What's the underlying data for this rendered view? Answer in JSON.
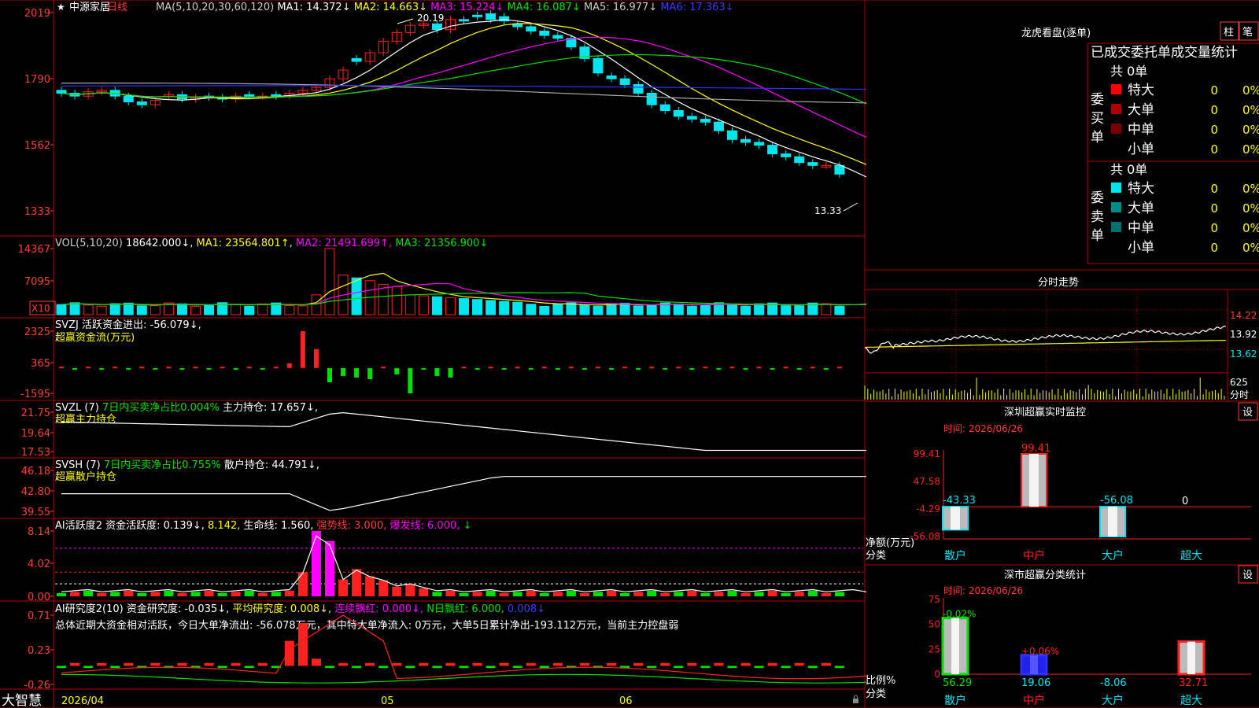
{
  "app": {
    "brand": "大智慧",
    "star": "★",
    "stock_name": "中源家居",
    "period": "日线"
  },
  "colors": {
    "bg": "#000000",
    "grid": "#b00000",
    "up": "#ff2020",
    "down": "#00e5ee",
    "axis_text": "#ff3b3b",
    "white": "#ffffff",
    "yellow": "#ffff00",
    "magenta": "#ff00ff",
    "green": "#00e000",
    "blue": "#3030ff",
    "gray": "#aaaaaa"
  },
  "panels": {
    "price": {
      "header": [
        {
          "t": "MA(5,10,20,30,60,120)",
          "c": "#cccccc"
        },
        {
          "t": "MA1: 14.372↓",
          "c": "#ffffff"
        },
        {
          "t": "MA2: 14.663↓",
          "c": "#ffff00"
        },
        {
          "t": "MA3: 15.224↓",
          "c": "#ff00ff"
        },
        {
          "t": "MA4: 16.087↓",
          "c": "#00e000"
        },
        {
          "t": "MA5: 16.977↓",
          "c": "#cccccc"
        },
        {
          "t": "MA6: 17.363↓",
          "c": "#3a3aff"
        }
      ],
      "y_ticks": [
        "2019",
        "1790",
        "1562",
        "1333"
      ],
      "high_label": "20.19",
      "low_label": "13.33"
    },
    "vol": {
      "header": [
        {
          "t": "VOL(5,10,20)",
          "c": "#cccccc"
        },
        {
          "t": "18642.000↓,",
          "c": "#ffffff"
        },
        {
          "t": "MA1: 23564.801↑,",
          "c": "#ffff00"
        },
        {
          "t": "MA2: 21491.699↑,",
          "c": "#ff00ff"
        },
        {
          "t": "MA3: 21356.900↓",
          "c": "#00e000"
        }
      ],
      "y_ticks": [
        "14367",
        "7095"
      ],
      "unit": "X10"
    },
    "svzj": {
      "header": [
        {
          "t": "SVZJ  活跃资金进出: -56.079↓,",
          "c": "#ffffff"
        }
      ],
      "sub": "超赢资金流(万元)",
      "y_ticks": [
        "2325",
        "365",
        "-1595"
      ]
    },
    "svzl": {
      "header": [
        {
          "t": "SVZL (7)",
          "c": "#ffffff"
        },
        {
          "t": "7日内买卖净占比0.004%",
          "c": "#00e000"
        },
        {
          "t": "主力持仓: 17.657↓,",
          "c": "#ffffff"
        }
      ],
      "sub": "超赢主力持仓",
      "y_ticks": [
        "21.75",
        "19.64",
        "17.53"
      ]
    },
    "svsh": {
      "header": [
        {
          "t": "SVSH (7)",
          "c": "#ffffff"
        },
        {
          "t": "7日内买卖净占比0.755%",
          "c": "#00e000"
        },
        {
          "t": "散户持仓: 44.791↓,",
          "c": "#ffffff"
        }
      ],
      "sub": "超赢散户持仓",
      "y_ticks": [
        "46.18",
        "42.80",
        "39.55"
      ]
    },
    "ai1": {
      "header": [
        {
          "t": "AI活跃度2",
          "c": "#ffffff"
        },
        {
          "t": "资金活跃度: 0.139↓,",
          "c": "#ffffff"
        },
        {
          "t": "8.142,",
          "c": "#ffff00"
        },
        {
          "t": "生命线: 1.560,",
          "c": "#ffffff"
        },
        {
          "t": "强势线: 3.000,",
          "c": "#ff3b3b"
        },
        {
          "t": "爆发线: 6.000,",
          "c": "#ff00ff"
        },
        {
          "t": "↓",
          "c": "#00e000"
        }
      ],
      "y_ticks": [
        "8.14",
        "4.02",
        "0.00"
      ]
    },
    "ai2": {
      "header": [
        {
          "t": "AI研究度2(10)",
          "c": "#ffffff"
        },
        {
          "t": "资金研究度: -0.035↓,",
          "c": "#ffffff"
        },
        {
          "t": "平均研究度: 0.008↓,",
          "c": "#ffff00"
        },
        {
          "t": "连续飘红: 0.000↓,",
          "c": "#ff00ff"
        },
        {
          "t": "N日飘红: 6.000,",
          "c": "#00e000"
        },
        {
          "t": "0.008↓",
          "c": "#3a3aff"
        }
      ],
      "summary": "总体近期大资金相对活跃，今日大单净流出: -56.078万元，其中特大单净流入: 0万元，大单5日累计净出-193.112万元，当前主力控盘弱",
      "y_ticks": [
        "0.71",
        "0.23",
        "-0.26"
      ]
    }
  },
  "x_axis": {
    "labels": [
      "2026/04",
      "05",
      "06"
    ]
  },
  "right": {
    "lhb_title": "龙虎看盘(逐单)",
    "btn_bar": "柱",
    "btn_pen": "笔",
    "stats_title": "已成交委托单成交量统计",
    "buy": {
      "label": "委买单",
      "total": "共 0单",
      "rows": [
        {
          "name": "特大",
          "v": "0",
          "p": "0%",
          "c": "#ff0000"
        },
        {
          "name": "大单",
          "v": "0",
          "p": "0%",
          "c": "#aa0000"
        },
        {
          "name": "中单",
          "v": "0",
          "p": "0%",
          "c": "#770000"
        },
        {
          "name": "小单",
          "v": "0",
          "p": "0%",
          "c": ""
        }
      ]
    },
    "sell": {
      "label": "委卖单",
      "total": "共 0单",
      "rows": [
        {
          "name": "特大",
          "v": "0",
          "p": "0%",
          "c": "#00e5ee"
        },
        {
          "name": "大单",
          "v": "0",
          "p": "0%",
          "c": "#008a8a"
        },
        {
          "name": "中单",
          "v": "0",
          "p": "0%",
          "c": "#006f6f"
        },
        {
          "name": "小单",
          "v": "0",
          "p": "0%",
          "c": ""
        }
      ]
    },
    "intraday": {
      "title": "分时走势",
      "prices": [
        "14.22",
        "13.92",
        "13.62"
      ],
      "vol": "625",
      "vol_unit": "分时"
    },
    "monitor": {
      "title": "深圳超赢实时监控",
      "set": "设",
      "time": "时间: 2026/06/26",
      "y_ticks": [
        "99.41",
        "47.58",
        "-4.29",
        "-56.08"
      ],
      "ylabel": "净额(万元)",
      "xlabel": "分类",
      "bars": [
        {
          "cat": "散户",
          "v": -43.33,
          "label": "-43.33"
        },
        {
          "cat": "中户",
          "v": 99.41,
          "label": "99.41"
        },
        {
          "cat": "大户",
          "v": -56.08,
          "label": "-56.08"
        },
        {
          "cat": "超大",
          "v": 0,
          "label": "0"
        }
      ]
    },
    "cls": {
      "title": "深市超赢分类统计",
      "set": "设",
      "time": "时间: 2026/06/26",
      "y_ticks": [
        "75",
        "50",
        "25",
        "0"
      ],
      "ylabel": "比例%",
      "xlabel": "分类",
      "bars": [
        {
          "cat": "散户",
          "v": 56.29,
          "label": "56.29",
          "pct": "-0.02%"
        },
        {
          "cat": "中户",
          "v": 19.06,
          "label": "19.06",
          "pct": "+0.06%"
        },
        {
          "cat": "大户",
          "v": -8.06,
          "label": "-8.06",
          "pct": ""
        },
        {
          "cat": "超大",
          "v": 32.71,
          "label": "32.71",
          "pct": ""
        }
      ]
    }
  }
}
